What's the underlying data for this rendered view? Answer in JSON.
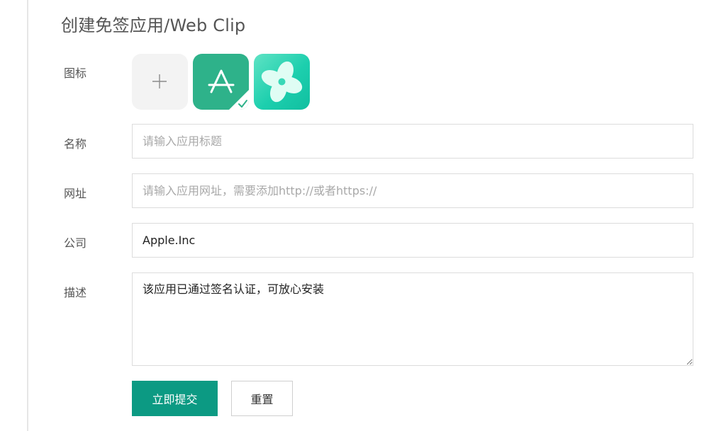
{
  "page": {
    "title": "创建免签应用/Web Clip"
  },
  "form": {
    "icon_label": "图标",
    "icons": [
      {
        "name": "add-icon",
        "selected": false
      },
      {
        "name": "app-store-icon",
        "selected": true
      },
      {
        "name": "pinwheel-app-icon",
        "selected": false
      }
    ],
    "name_label": "名称",
    "name_value": "",
    "name_placeholder": "请输入应用标题",
    "url_label": "网址",
    "url_value": "",
    "url_placeholder": "请输入应用网址，需要添加http://或者https://",
    "company_label": "公司",
    "company_value": "Apple.Inc",
    "description_label": "描述",
    "description_value": "该应用已通过签名认证，可放心安装"
  },
  "buttons": {
    "submit_label": "立即提交",
    "reset_label": "重置"
  },
  "colors": {
    "primary": "#0c9a83",
    "store_icon_bg": "#2eb28a",
    "border": "#dcdcdc"
  }
}
